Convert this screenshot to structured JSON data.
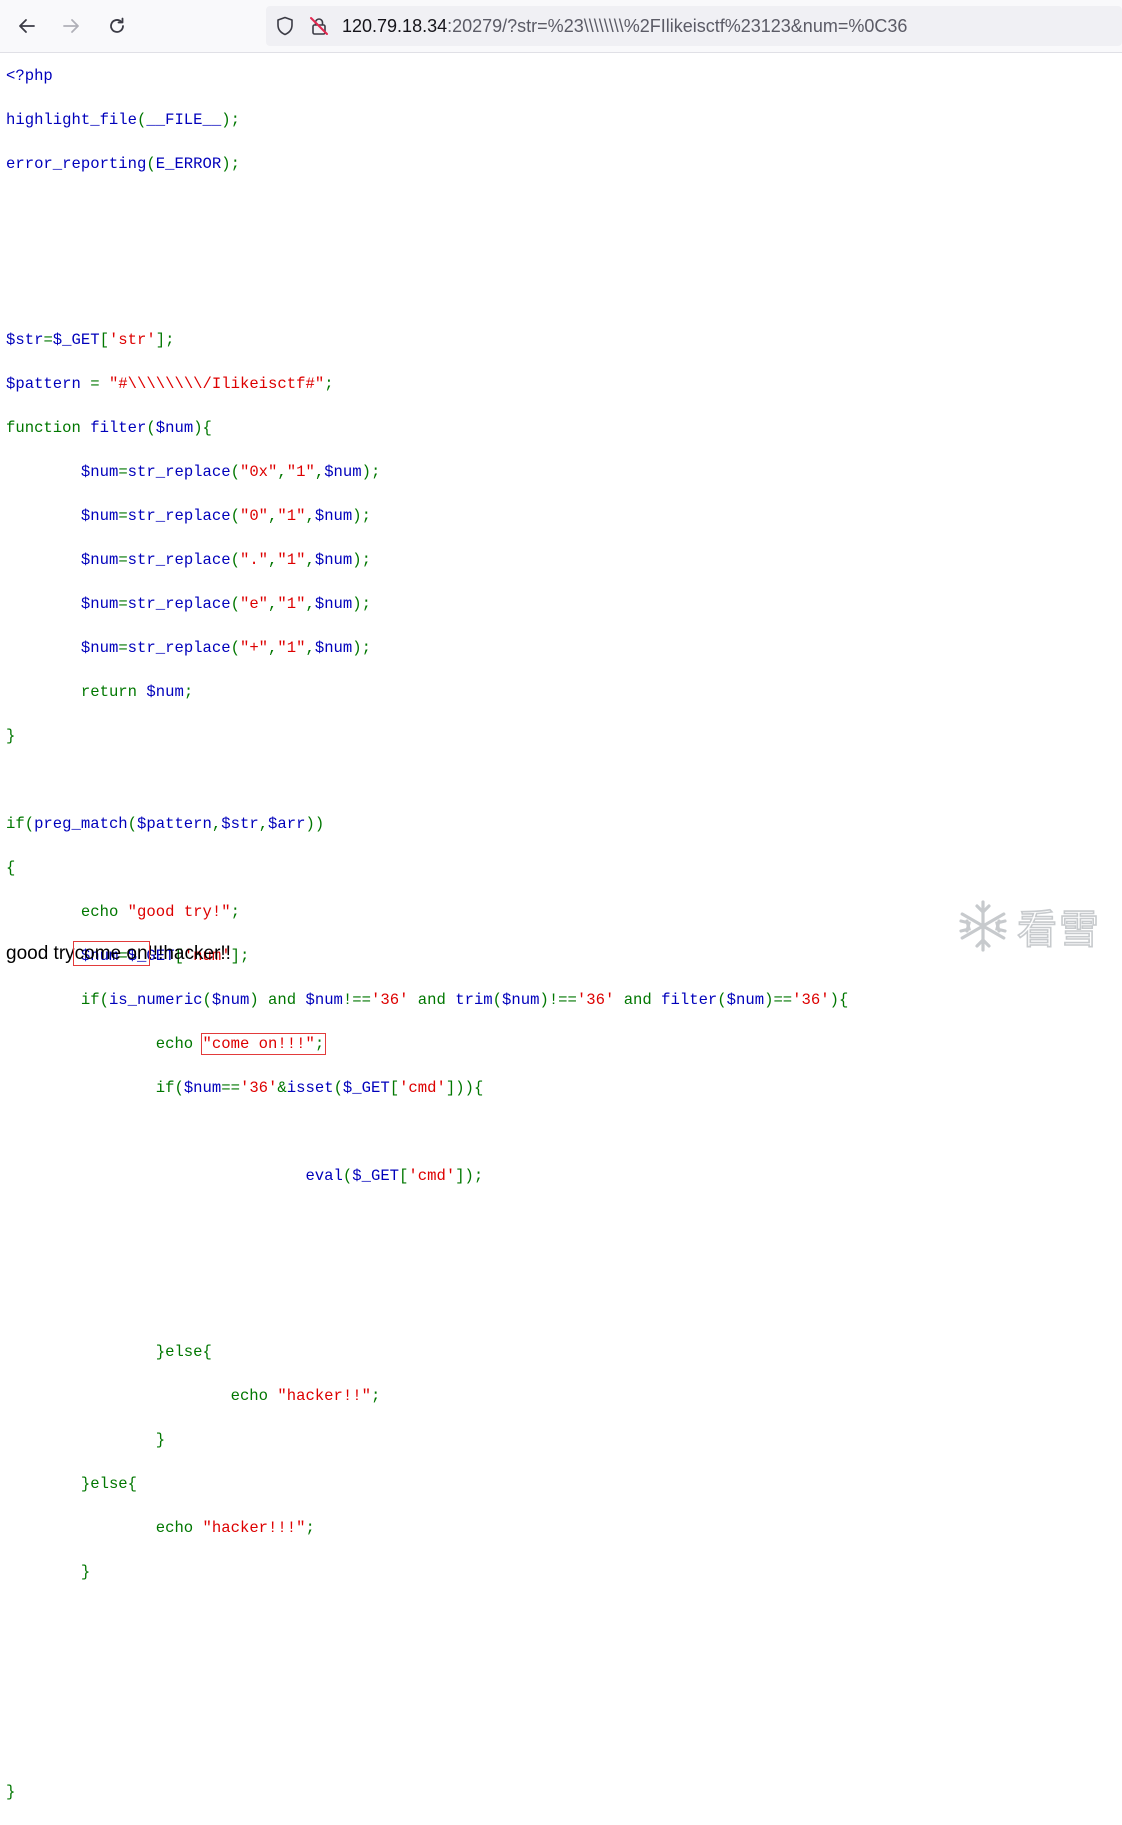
{
  "browser": {
    "url_host": "120.79.18.34",
    "url_rest": ":20279/?str=%23\\\\\\\\\\\\\\\\%2FIlikeisctf%23123&num=%0C36"
  },
  "code": {
    "l0": "<?php",
    "l1a": "highlight_file",
    "l1b": "(",
    "l1c": "__FILE__",
    "l1d": ");",
    "l2a": "error_reporting",
    "l2b": "(",
    "l2c": "E_ERROR",
    "l2d": ");",
    "l6a": "$str",
    "l6b": "=",
    "l6c": "$_GET",
    "l6d": "[",
    "l6e": "'str'",
    "l6f": "];",
    "l7a": "$pattern",
    "l7b": " = ",
    "l7c": "\"#\\\\\\\\\\\\\\\\/Ilikeisctf#\"",
    "l7d": ";",
    "l8a": "function ",
    "l8b": "filter",
    "l8c": "(",
    "l8d": "$num",
    "l8e": "){",
    "r1a": "$num",
    "r1b": "=",
    "r1c": "str_replace",
    "r1d": "(",
    "r1e": "\"0x\"",
    "r1f": ",",
    "r1g": "\"1\"",
    "r1h": ",",
    "r1i": "$num",
    "r1j": ");",
    "r2a": "$num",
    "r2b": "=",
    "r2c": "str_replace",
    "r2d": "(",
    "r2e": "\"0\"",
    "r2f": ",",
    "r2g": "\"1\"",
    "r2h": ",",
    "r2i": "$num",
    "r2j": ");",
    "r3a": "$num",
    "r3b": "=",
    "r3c": "str_replace",
    "r3d": "(",
    "r3e": "\".\"",
    "r3f": ",",
    "r3g": "\"1\"",
    "r3h": ",",
    "r3i": "$num",
    "r3j": ");",
    "r4a": "$num",
    "r4b": "=",
    "r4c": "str_replace",
    "r4d": "(",
    "r4e": "\"e\"",
    "r4f": ",",
    "r4g": "\"1\"",
    "r4h": ",",
    "r4i": "$num",
    "r4j": ");",
    "r5a": "$num",
    "r5b": "=",
    "r5c": "str_replace",
    "r5d": "(",
    "r5e": "\"+\"",
    "r5f": ",",
    "r5g": "\"1\"",
    "r5h": ",",
    "r5i": "$num",
    "r5j": ");",
    "rt1": "return ",
    "rt2": "$num",
    "rt3": ";",
    "close": "}",
    "if1a": "if(",
    "if1b": "preg_match",
    "if1c": "(",
    "if1d": "$pattern",
    "if1e": ",",
    "if1f": "$str",
    "if1g": ",",
    "if1h": "$arr",
    "if1i": "))",
    "ob": "{",
    "e1a": "echo ",
    "e1b": "\"good try!\"",
    "e1c": ";",
    "n1a": "$num",
    "n1b": "=",
    "n1c": "$_GET",
    "n1d": "[",
    "n1e": "'num'",
    "n1f": "];",
    "c1": "if(",
    "c2": "is_numeric",
    "c3": "(",
    "c4": "$num",
    "c5": ") and ",
    "c6": "$num",
    "c7": "!==",
    "c8": "'36'",
    "c9": " and ",
    "c10": "trim",
    "c11": "(",
    "c12": "$num",
    "c13": ")!==",
    "c14": "'36'",
    "c15": " and ",
    "c16": "filter",
    "c17": "(",
    "c18": "$num",
    "c19": ")==",
    "c20": "'36'",
    "c21": "){",
    "e2a": "echo ",
    "e2b": "\"come on!!!\"",
    "e2c": ";",
    "d1": "if(",
    "d2": "$num",
    "d3": "==",
    "d4": "'36'",
    "d5": "&",
    "d6": "isset",
    "d7": "(",
    "d8": "$_GET",
    "d9": "[",
    "d10": "'cmd'",
    "d11": "])){",
    "v1": "eval",
    "v2": "(",
    "v3": "$_GET",
    "v4": "[",
    "v5": "'cmd'",
    "v6": "]);",
    "el1": "}else{",
    "e3a": "echo ",
    "e3b": "\"hacker!!\"",
    "e3c": ";",
    "cb": "}",
    "el2": "}else{",
    "e4a": "echo ",
    "e4b": "\"hacker!!!\"",
    "e4c": ";",
    "cb2": "}",
    "cb3": "}"
  },
  "output": {
    "part1": "good try",
    "part2": "come on",
    "part3": "!!!hacker!!"
  },
  "watermark": {
    "text": "看雪"
  },
  "icons": [
    "back-arrow-icon",
    "forward-arrow-icon",
    "reload-icon",
    "shield-icon",
    "insecure-lock-icon",
    "snowflake-icon"
  ]
}
